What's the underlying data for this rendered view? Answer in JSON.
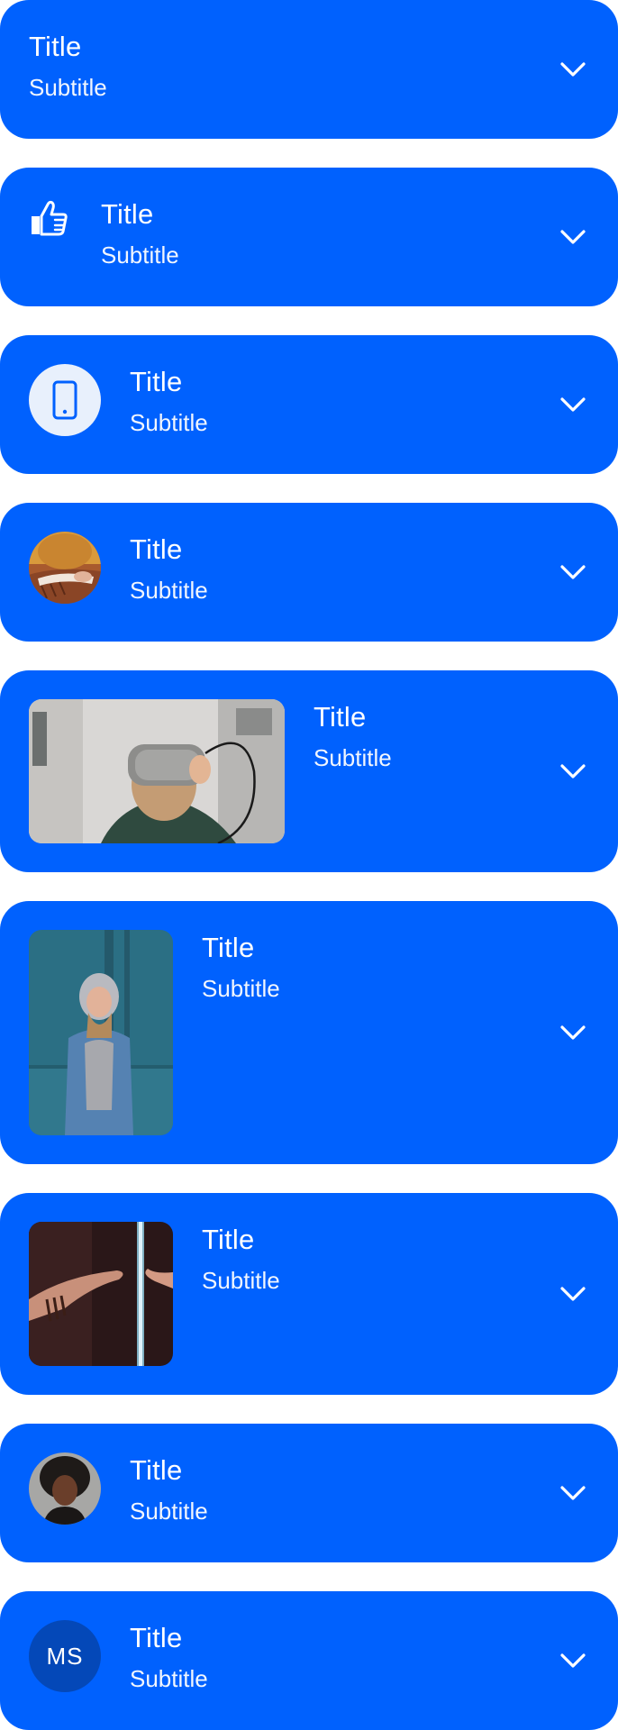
{
  "items": [
    {
      "title": "Title",
      "subtitle": "Subtitle",
      "lead": "none"
    },
    {
      "title": "Title",
      "subtitle": "Subtitle",
      "lead": "thumbs-up-icon"
    },
    {
      "title": "Title",
      "subtitle": "Subtitle",
      "lead": "smartphone-icon"
    },
    {
      "title": "Title",
      "subtitle": "Subtitle",
      "lead": "avatar-photo-knitting"
    },
    {
      "title": "Title",
      "subtitle": "Subtitle",
      "lead": "landscape-photo-vr-headset"
    },
    {
      "title": "Title",
      "subtitle": "Subtitle",
      "lead": "portrait-photo-person-hoodie"
    },
    {
      "title": "Title",
      "subtitle": "Subtitle",
      "lead": "square-photo-hands-mirror"
    },
    {
      "title": "Title",
      "subtitle": "Subtitle",
      "lead": "avatar-photo-person"
    },
    {
      "title": "Title",
      "subtitle": "Subtitle",
      "lead": "avatar-initials",
      "initials": "MS"
    }
  ],
  "icons": {
    "expand": "chevron-down-icon"
  },
  "colors": {
    "card_background": "#0061fe",
    "text": "#ffffff",
    "icon_badge": "#e8f0fc",
    "initials_badge": "#0448b8"
  }
}
